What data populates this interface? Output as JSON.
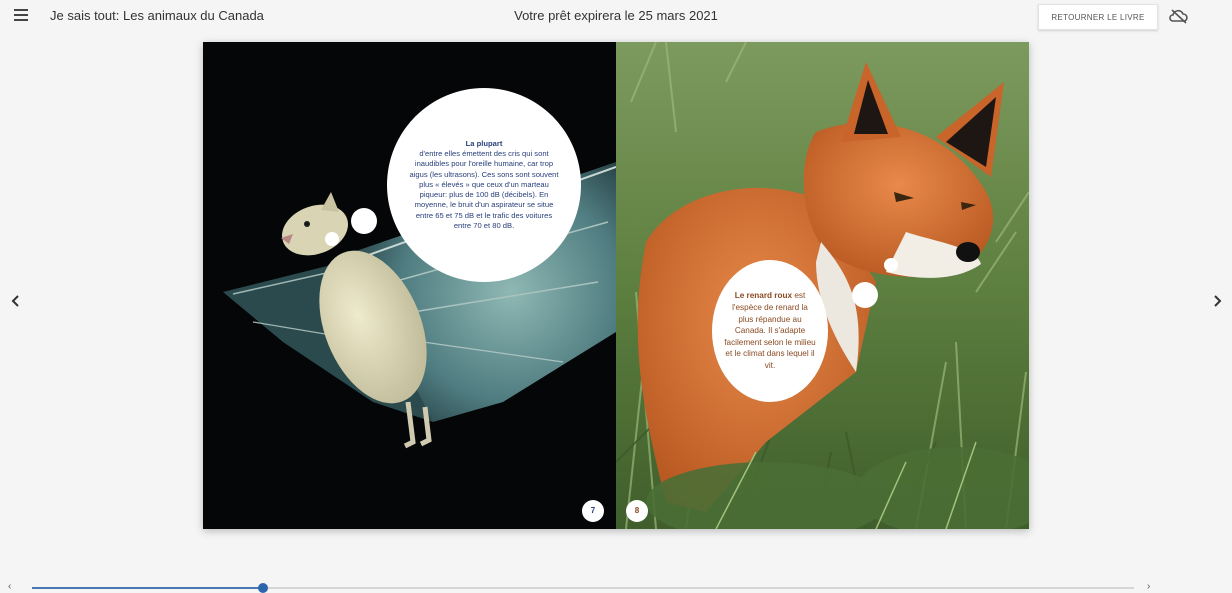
{
  "header": {
    "menu_icon": "hamburger-menu-icon",
    "book_title": "Je sais tout: Les animaux du Canada",
    "loan_message": "Votre prêt expirera le 25 mars 2021",
    "return_button_label": "RETOURNER LE LIVRE",
    "cloud_icon": "cloud-sync-icon"
  },
  "navigation": {
    "prev_icon": "chevron-left-icon",
    "next_icon": "chevron-right-icon"
  },
  "spread": {
    "left_page": {
      "bubble_bold": "La plupart",
      "bubble_text": "d'entre elles émettent des cris qui sont inaudibles pour l'oreille humaine, car trop aigus (les ultrasons). Ces sons sont souvent plus « élevés » que ceux d'un marteau piqueur: plus de 100 dB (décibels). En moyenne, le bruit d'un aspirateur se situe entre 65 et 75 dB et le trafic des voitures entre 70 et 80 dB.",
      "page_number": "7",
      "accent_color": "#273f7a"
    },
    "right_page": {
      "bubble_bold": "Le renard roux",
      "bubble_text": "est l'espèce de renard la plus répandue au Canada. Il s'adapte facilement selon le milieu et le climat dans lequel il vit.",
      "page_number": "8",
      "accent_color": "#8a4a22"
    }
  },
  "progress": {
    "value_fraction": 0.21,
    "prev_label": "‹",
    "next_label": "›",
    "color": "#2e66ad"
  }
}
